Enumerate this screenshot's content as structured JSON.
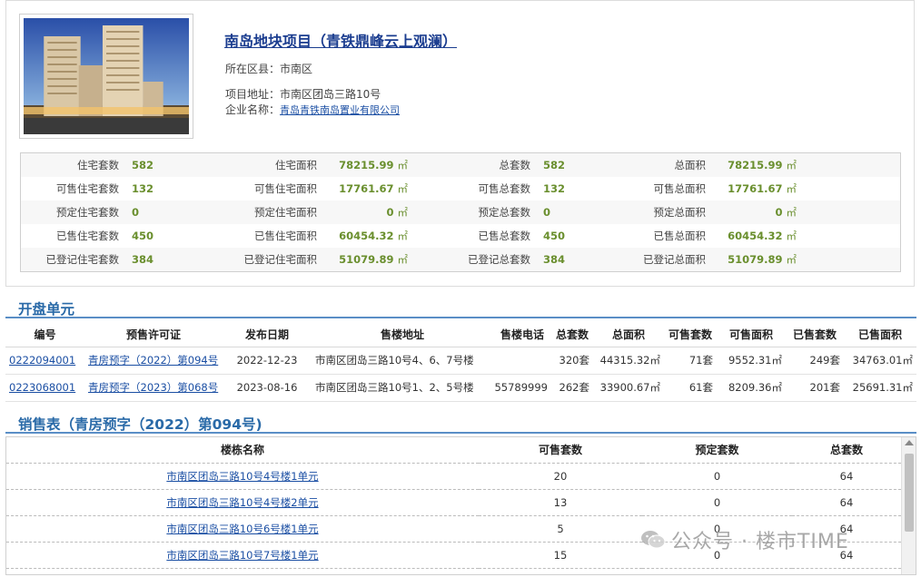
{
  "project": {
    "title": "南岛地块项目（青铁鼎峰云上观澜）",
    "district_label": "所在区县：",
    "district": "市南区",
    "address_label": "项目地址：",
    "address": "市南区团岛三路10号",
    "company_label": "企业名称：",
    "company": "青岛青铁南岛置业有限公司",
    "photo_icon": "building-photo"
  },
  "stats": {
    "unit": "㎡",
    "rows": [
      {
        "l1": "住宅套数",
        "v1": "582",
        "l2": "住宅面积",
        "v2": "78215.99",
        "l3": "总套数",
        "v3": "582",
        "l4": "总面积",
        "v4": "78215.99"
      },
      {
        "l1": "可售住宅套数",
        "v1": "132",
        "l2": "可售住宅面积",
        "v2": "17761.67",
        "l3": "可售总套数",
        "v3": "132",
        "l4": "可售总面积",
        "v4": "17761.67"
      },
      {
        "l1": "预定住宅套数",
        "v1": "0",
        "l2": "预定住宅面积",
        "v2": "0",
        "l3": "预定总套数",
        "v3": "0",
        "l4": "预定总面积",
        "v4": "0"
      },
      {
        "l1": "已售住宅套数",
        "v1": "450",
        "l2": "已售住宅面积",
        "v2": "60454.32",
        "l3": "已售总套数",
        "v3": "450",
        "l4": "已售总面积",
        "v4": "60454.32"
      },
      {
        "l1": "已登记住宅套数",
        "v1": "384",
        "l2": "已登记住宅面积",
        "v2": "51079.89",
        "l3": "已登记总套数",
        "v3": "384",
        "l4": "已登记总面积",
        "v4": "51079.89"
      }
    ]
  },
  "units_section": {
    "title": "开盘单元",
    "headers": [
      "编号",
      "预售许可证",
      "发布日期",
      "售楼地址",
      "售楼电话",
      "总套数",
      "总面积",
      "可售套数",
      "可售面积",
      "已售套数",
      "已售面积"
    ],
    "rows": [
      [
        "0222094001",
        "青房预字（2022）第094号",
        "2022-12-23",
        "市南区团岛三路10号4、6、7号楼",
        "",
        "320套",
        "44315.32㎡",
        "71套",
        "9552.31㎡",
        "249套",
        "34763.01㎡"
      ],
      [
        "0223068001",
        "青房预字（2023）第068号",
        "2023-08-16",
        "市南区团岛三路10号1、2、5号楼",
        "55789999",
        "262套",
        "33900.67㎡",
        "61套",
        "8209.36㎡",
        "201套",
        "25691.31㎡"
      ]
    ]
  },
  "sales_section": {
    "title": "销售表（青房预字（2022）第094号)",
    "headers": [
      "楼栋名称",
      "可售套数",
      "预定套数",
      "总套数"
    ],
    "rows": [
      [
        "市南区团岛三路10号4号楼1单元",
        "20",
        "0",
        "64"
      ],
      [
        "市南区团岛三路10号4号楼2单元",
        "13",
        "0",
        "64"
      ],
      [
        "市南区团岛三路10号6号楼1单元",
        "5",
        "0",
        "64"
      ],
      [
        "市南区团岛三路10号7号楼1单元",
        "15",
        "0",
        "64"
      ]
    ]
  },
  "watermark": {
    "text": "公众号 · 楼市TIME",
    "icon": "wechat-icon"
  }
}
